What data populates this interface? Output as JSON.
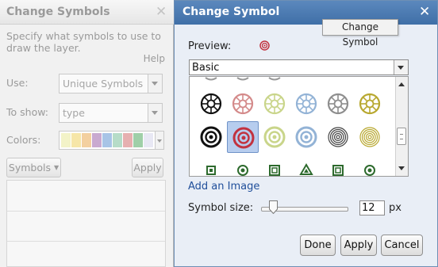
{
  "left_panel": {
    "title": "Change Symbols",
    "description": "Specify what symbols to use to draw the layer.",
    "help": "Help",
    "use_label": "Use:",
    "use_value": "Unique Symbols",
    "show_label": "To show:",
    "show_value": "type",
    "colors_label": "Colors:",
    "palette": [
      "#f3f3c8",
      "#f6e6a8",
      "#f3d0a0",
      "#c9aad0",
      "#a8c4e6",
      "#b6dcc8",
      "#e6b0b0",
      "#9fcfa8",
      "#e8e8f4"
    ],
    "symbols_button": "Symbols",
    "apply_button": "Apply"
  },
  "dialog": {
    "title": "Change Symbol",
    "tooltip": "Change Symbol",
    "preview_label": "Preview:",
    "symbol_type": "Basic",
    "symbol_grid": {
      "rows": [
        [
          {
            "style": "wheel",
            "color": "#111111"
          },
          {
            "style": "wheel",
            "color": "#d48a8a"
          },
          {
            "style": "wheel",
            "color": "#c9d58a"
          },
          {
            "style": "wheel",
            "color": "#93b3d6"
          },
          {
            "style": "wheel",
            "color": "#8e8e8e"
          },
          {
            "style": "wheel",
            "color": "#b8a830"
          }
        ],
        [
          {
            "style": "target",
            "color": "#111111"
          },
          {
            "style": "target",
            "color": "#c2323f",
            "selected": true
          },
          {
            "style": "target",
            "color": "#c9d58a"
          },
          {
            "style": "target",
            "color": "#93b3d6"
          },
          {
            "style": "rings",
            "color": "#444444"
          },
          {
            "style": "rings",
            "color": "#b8a830"
          }
        ],
        [
          {
            "style": "square",
            "color": "#2d6a2d"
          },
          {
            "style": "circle",
            "color": "#2d6a2d"
          },
          {
            "style": "square-out",
            "color": "#2d6a2d"
          },
          {
            "style": "triangle",
            "color": "#2d6a2d"
          },
          {
            "style": "square-out",
            "color": "#2d6a2d"
          },
          {
            "style": "circle",
            "color": "#2d6a2d"
          }
        ]
      ]
    },
    "add_image": "Add an Image",
    "size_label": "Symbol size:",
    "size_value": "12",
    "size_fraction": 0.1,
    "size_unit": "px",
    "done": "Done",
    "apply": "Apply",
    "cancel": "Cancel",
    "accent_color": "#4a7ab3",
    "selected_color": "#c2323f"
  }
}
